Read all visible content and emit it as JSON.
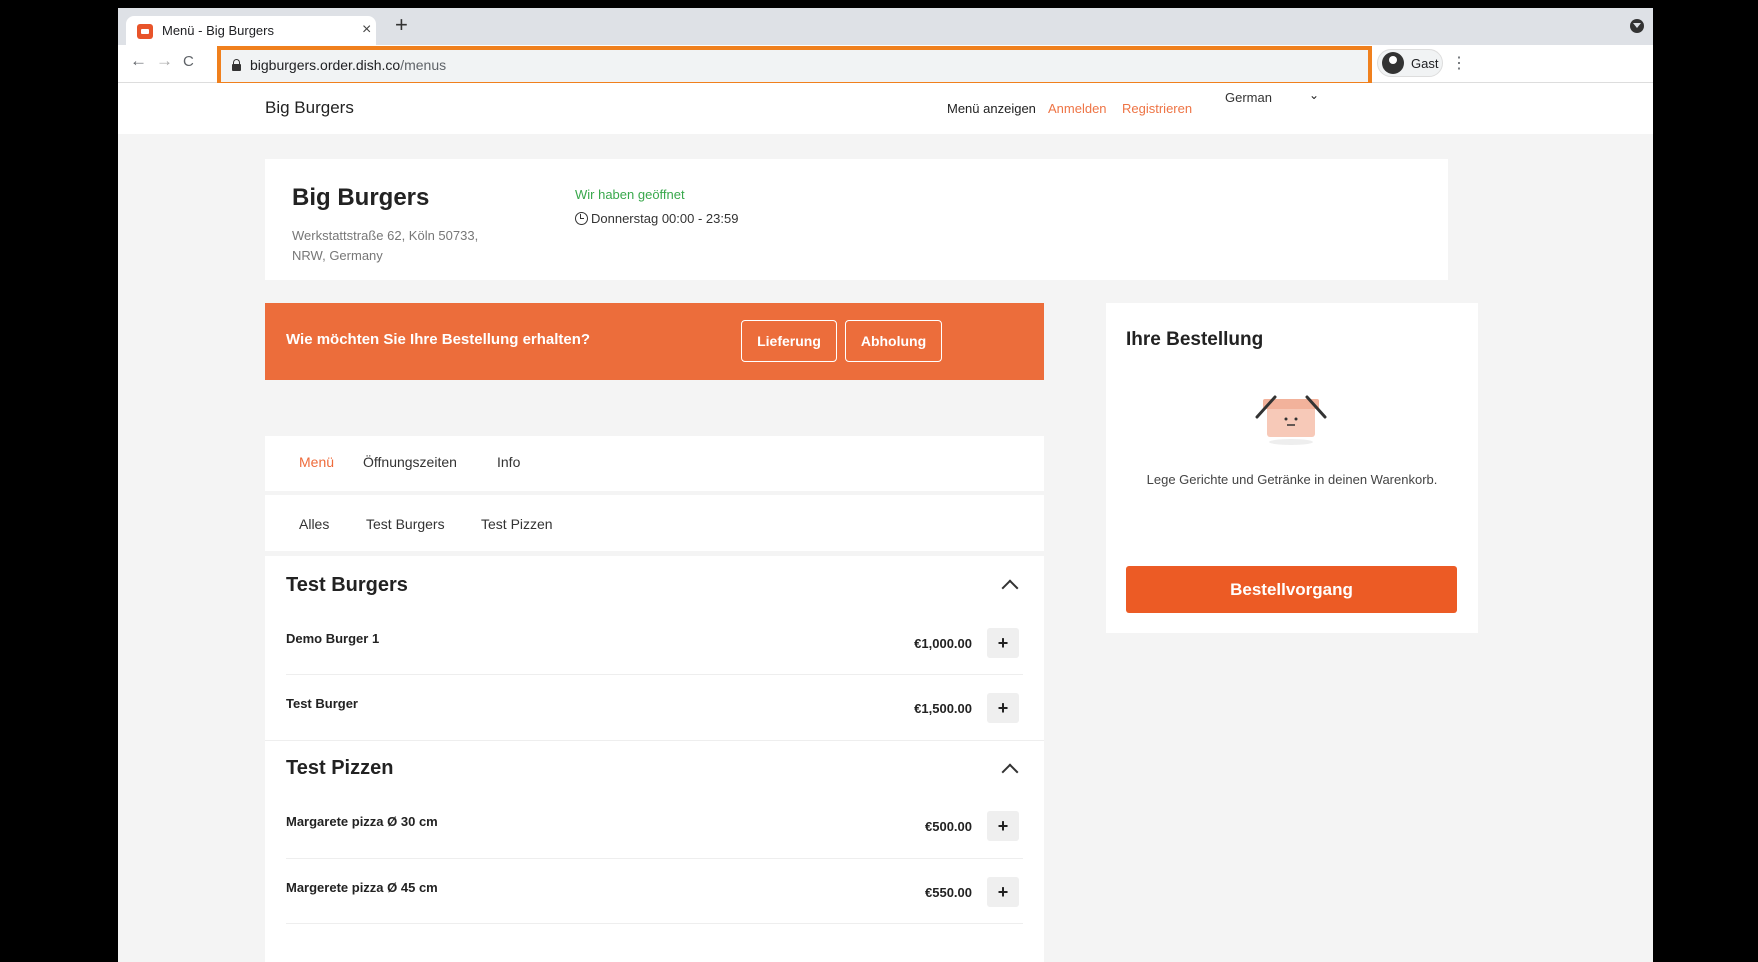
{
  "browser": {
    "tab_title": "Menü - Big Burgers",
    "tab_close": "×",
    "new_tab": "+",
    "url_host": "bigburgers.order.dish.co",
    "url_path": "/menus",
    "back": "←",
    "forward": "→",
    "reload": "C",
    "profile_label": "Gast",
    "menu_icon": "⋮"
  },
  "header": {
    "brand": "Big Burgers",
    "show_menu": "Menü anzeigen",
    "login": "Anmelden",
    "register": "Registrieren",
    "language": "German",
    "language_chevron": "⌄"
  },
  "restaurant": {
    "name": "Big Burgers",
    "address": "Werkstattstraße 62, Köln 50733, NRW, Germany",
    "open_status": "Wir haben geöffnet",
    "hours": "Donnerstag 00:00 - 23:59"
  },
  "delivery_banner": {
    "question": "Wie möchten Sie Ihre Bestellung erhalten?",
    "delivery": "Lieferung",
    "pickup": "Abholung"
  },
  "tabs": [
    "Menü",
    "Öffnungszeiten",
    "Info"
  ],
  "categories": [
    "Alles",
    "Test Burgers",
    "Test Pizzen"
  ],
  "sections": [
    {
      "title": "Test Burgers",
      "items": [
        {
          "name": "Demo Burger 1",
          "price": "€1,000.00"
        },
        {
          "name": "Test Burger",
          "price": "€1,500.00"
        }
      ]
    },
    {
      "title": "Test Pizzen",
      "items": [
        {
          "name": "Margarete pizza Ø 30 cm",
          "price": "€500.00"
        },
        {
          "name": "Margerete pizza Ø 45 cm",
          "price": "€550.00"
        }
      ]
    }
  ],
  "add_symbol": "+",
  "order": {
    "title": "Ihre Bestellung",
    "empty_text": "Lege Gerichte und Getränke in deinen Warenkorb.",
    "checkout": "Bestellvorgang"
  },
  "colors": {
    "accent": "#ec6d3b",
    "highlight": "#f0801d",
    "open_green": "#39a84c"
  }
}
